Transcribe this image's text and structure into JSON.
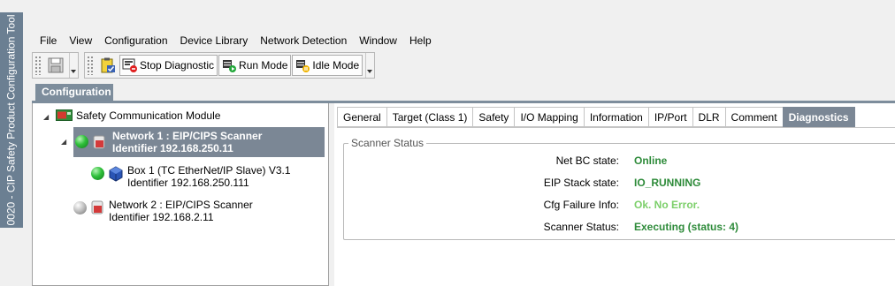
{
  "app": {
    "window_title": "0020 - CIP Safety Product Configuration Tool"
  },
  "menu": [
    "File",
    "View",
    "Configuration",
    "Device Library",
    "Network Detection",
    "Window",
    "Help"
  ],
  "toolbar": {
    "stop_diagnostic_label": "Stop Diagnostic",
    "run_mode_label": "Run Mode",
    "idle_mode_label": "Idle Mode"
  },
  "panel": {
    "title": "Configuration"
  },
  "tree": {
    "root_label": "Safety Communication Module",
    "network1": {
      "line1": "Network 1 : EIP/CIPS Scanner",
      "line2": "Identifier 192.168.250.11",
      "status": "green"
    },
    "box1": {
      "line1": "Box 1 (TC EtherNet/IP Slave) V3.1",
      "line2": "Identifier 192.168.250.111",
      "status": "green"
    },
    "network2": {
      "line1": "Network 2 : EIP/CIPS Scanner",
      "line2": "Identifier 192.168.2.11",
      "status": "gray"
    }
  },
  "tabs": [
    "General",
    "Target (Class 1)",
    "Safety",
    "I/O Mapping",
    "Information",
    "IP/Port",
    "DLR",
    "Comment",
    "Diagnostics"
  ],
  "active_tab": "Diagnostics",
  "scanner_status": {
    "group_title": "Scanner Status",
    "rows": [
      {
        "label": "Net BC state:",
        "value": "Online",
        "color": "#2e8b3a"
      },
      {
        "label": "EIP Stack state:",
        "value": "IO_RUNNING",
        "color": "#2e8b3a"
      },
      {
        "label": "Cfg Failure Info:",
        "value": "Ok. No Error.",
        "color": "#7ccf6a"
      },
      {
        "label": "Scanner Status:",
        "value": "Executing (status: 4)",
        "color": "#2e8b3a"
      }
    ]
  },
  "colors": {
    "accent": "#7b8795",
    "status_ok": "#2e8b3a"
  }
}
